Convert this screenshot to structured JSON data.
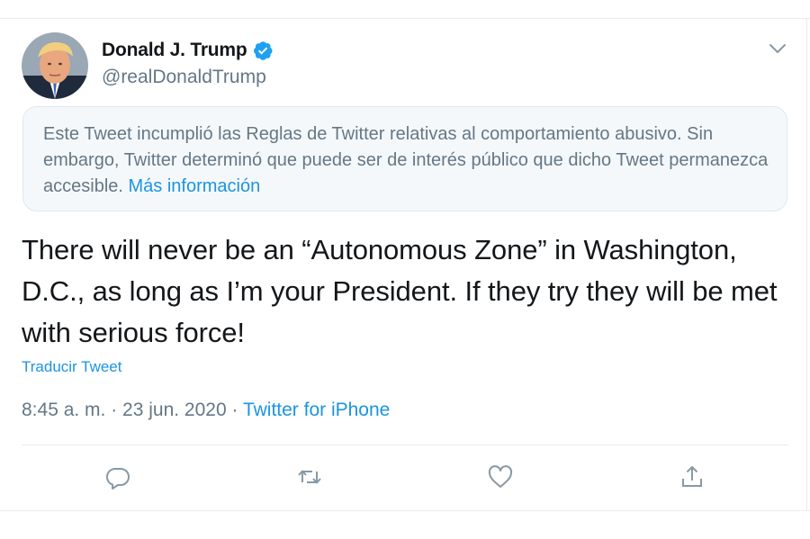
{
  "author": {
    "display_name": "Donald J. Trump",
    "handle": "@realDonaldTrump",
    "verified": true
  },
  "notice": {
    "text": "Este Tweet incumplió las Reglas de Twitter relativas al comportamiento abusivo. Sin embargo, Twitter determinó que puede ser de interés público que dicho Tweet permanezca accesible. ",
    "link_label": "Más información"
  },
  "tweet": {
    "text": "There will never be an “Autonomous Zone” in Washington, D.C., as long as I’m your President. If they try they will be met with serious force!",
    "translate_label": "Traducir Tweet",
    "timestamp": "8:45 a. m. · 23 jun. 2020 · ",
    "source": "Twitter for iPhone"
  },
  "actions": {
    "icons": [
      "reply-icon",
      "retweet-icon",
      "like-icon",
      "share-icon"
    ]
  },
  "colors": {
    "accent": "#1b95e0",
    "verified_badge": "#1da1f2",
    "secondary_text": "#657786",
    "notice_background": "#f5f8fa",
    "primary_text": "#14171a"
  }
}
